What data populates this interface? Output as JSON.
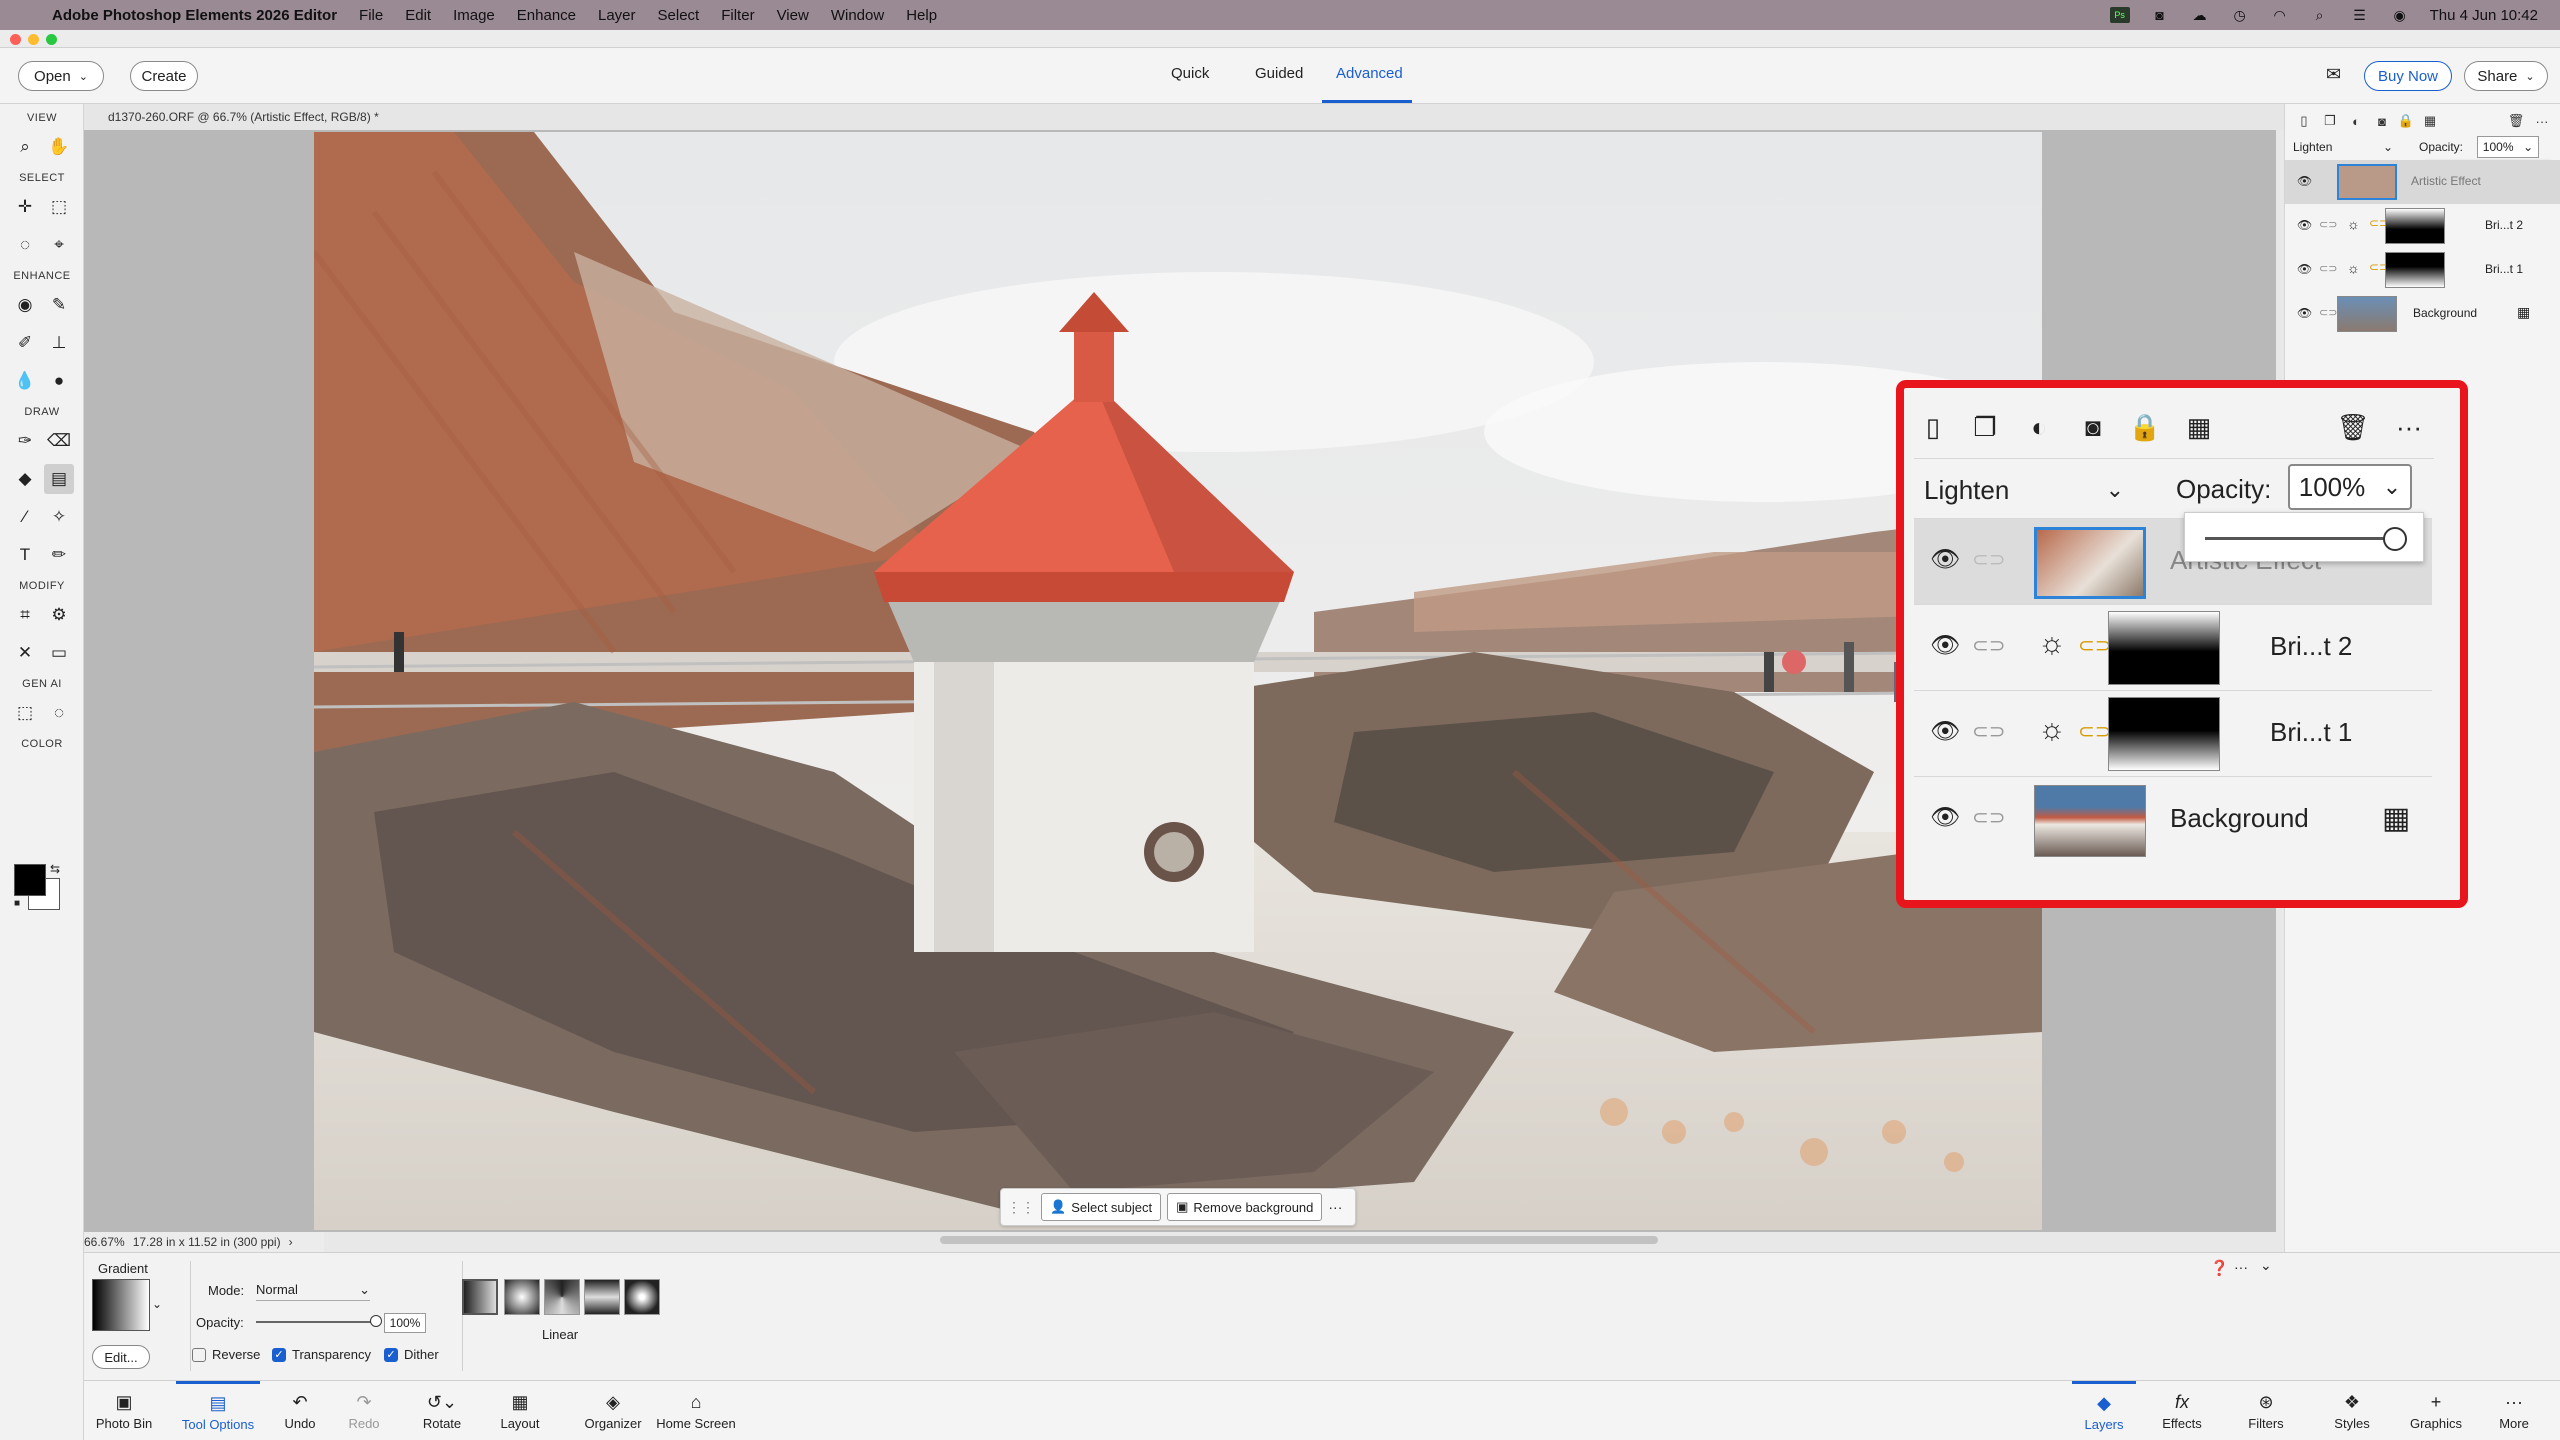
{
  "menubar": {
    "app_name": "Adobe Photoshop Elements 2026 Editor",
    "items": [
      "File",
      "Edit",
      "Image",
      "Enhance",
      "Layer",
      "Select",
      "Filter",
      "View",
      "Window",
      "Help"
    ],
    "clock": "Thu 4 Jun  10:42"
  },
  "appbar": {
    "open_label": "Open",
    "create_label": "Create",
    "modes": [
      "Quick",
      "Guided",
      "Advanced"
    ],
    "active_mode": "Advanced",
    "buy_label": "Buy Now",
    "share_label": "Share"
  },
  "toolbox": {
    "sections": [
      "VIEW",
      "SELECT",
      "ENHANCE",
      "DRAW",
      "MODIFY",
      "GEN AI",
      "COLOR"
    ]
  },
  "document": {
    "tab_label": "d1370-260.ORF @ 66.7% (Artistic Effect, RGB/8) *",
    "zoom": "66.67%",
    "size": "17.28 in x 11.52 in (300 ppi)"
  },
  "floatbar": {
    "select_subject": "Select subject",
    "remove_background": "Remove background",
    "more": "···"
  },
  "layers_panel": {
    "blend_mode": "Lighten",
    "opacity_label": "Opacity:",
    "opacity_value": "100%",
    "opacity_level": 1.0,
    "layers": [
      {
        "name": "Artistic Effect",
        "selected": true
      },
      {
        "name": "Bri...t 2",
        "selected": false
      },
      {
        "name": "Bri...t 1",
        "selected": false
      },
      {
        "name": "Background",
        "selected": false
      }
    ]
  },
  "tool_options": {
    "tool_name": "Gradient",
    "edit_label": "Edit...",
    "mode_label": "Mode:",
    "mode_value": "Normal",
    "opacity_label": "Opacity:",
    "opacity_value": "100%",
    "reverse_label": "Reverse",
    "reverse_checked": false,
    "transparency_label": "Transparency",
    "transparency_checked": true,
    "dither_label": "Dither",
    "dither_checked": true,
    "gradient_type": "Linear"
  },
  "bottombar": {
    "left": [
      "Photo Bin",
      "Tool Options",
      "Undo",
      "Redo",
      "Rotate",
      "Layout",
      "Organizer",
      "Home Screen"
    ],
    "right": [
      "Layers",
      "Effects",
      "Filters",
      "Styles",
      "Graphics",
      "More"
    ]
  },
  "colors": {
    "accent": "#1a5fcf",
    "callout": "#e8161c",
    "menubar": "#9a8a94"
  }
}
